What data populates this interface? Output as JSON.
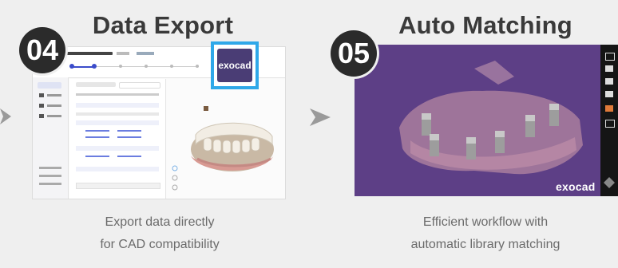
{
  "steps": [
    {
      "number": "04",
      "title": "Data Export",
      "caption_line1": "Export data directly",
      "caption_line2": "for CAD compatibility",
      "logo_text": "exocad"
    },
    {
      "number": "05",
      "title": "Auto Matching",
      "caption_line1": "Efficient workflow with",
      "caption_line2": "automatic library matching",
      "brand_text": "exocad"
    }
  ],
  "colors": {
    "background": "#efefef",
    "circle": "#2b2b2b",
    "highlight_border": "#2fa8e9",
    "exocad_logo_bg": "#4a3d75",
    "viewport_purple": "#5d3f86"
  }
}
